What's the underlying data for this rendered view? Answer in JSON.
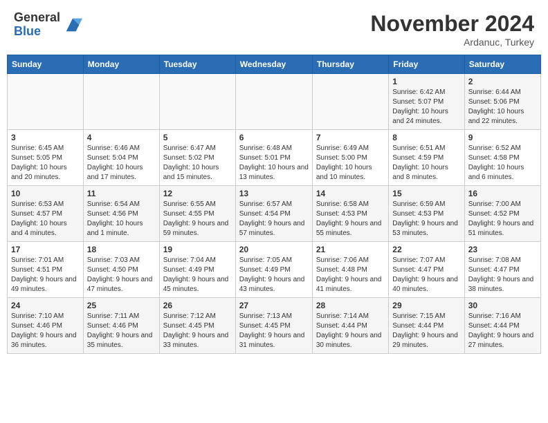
{
  "header": {
    "logo_general": "General",
    "logo_blue": "Blue",
    "month_title": "November 2024",
    "location": "Ardanuc, Turkey"
  },
  "weekdays": [
    "Sunday",
    "Monday",
    "Tuesday",
    "Wednesday",
    "Thursday",
    "Friday",
    "Saturday"
  ],
  "weeks": [
    [
      {
        "day": "",
        "info": ""
      },
      {
        "day": "",
        "info": ""
      },
      {
        "day": "",
        "info": ""
      },
      {
        "day": "",
        "info": ""
      },
      {
        "day": "",
        "info": ""
      },
      {
        "day": "1",
        "info": "Sunrise: 6:42 AM\nSunset: 5:07 PM\nDaylight: 10 hours and 24 minutes."
      },
      {
        "day": "2",
        "info": "Sunrise: 6:44 AM\nSunset: 5:06 PM\nDaylight: 10 hours and 22 minutes."
      }
    ],
    [
      {
        "day": "3",
        "info": "Sunrise: 6:45 AM\nSunset: 5:05 PM\nDaylight: 10 hours and 20 minutes."
      },
      {
        "day": "4",
        "info": "Sunrise: 6:46 AM\nSunset: 5:04 PM\nDaylight: 10 hours and 17 minutes."
      },
      {
        "day": "5",
        "info": "Sunrise: 6:47 AM\nSunset: 5:02 PM\nDaylight: 10 hours and 15 minutes."
      },
      {
        "day": "6",
        "info": "Sunrise: 6:48 AM\nSunset: 5:01 PM\nDaylight: 10 hours and 13 minutes."
      },
      {
        "day": "7",
        "info": "Sunrise: 6:49 AM\nSunset: 5:00 PM\nDaylight: 10 hours and 10 minutes."
      },
      {
        "day": "8",
        "info": "Sunrise: 6:51 AM\nSunset: 4:59 PM\nDaylight: 10 hours and 8 minutes."
      },
      {
        "day": "9",
        "info": "Sunrise: 6:52 AM\nSunset: 4:58 PM\nDaylight: 10 hours and 6 minutes."
      }
    ],
    [
      {
        "day": "10",
        "info": "Sunrise: 6:53 AM\nSunset: 4:57 PM\nDaylight: 10 hours and 4 minutes."
      },
      {
        "day": "11",
        "info": "Sunrise: 6:54 AM\nSunset: 4:56 PM\nDaylight: 10 hours and 1 minute."
      },
      {
        "day": "12",
        "info": "Sunrise: 6:55 AM\nSunset: 4:55 PM\nDaylight: 9 hours and 59 minutes."
      },
      {
        "day": "13",
        "info": "Sunrise: 6:57 AM\nSunset: 4:54 PM\nDaylight: 9 hours and 57 minutes."
      },
      {
        "day": "14",
        "info": "Sunrise: 6:58 AM\nSunset: 4:53 PM\nDaylight: 9 hours and 55 minutes."
      },
      {
        "day": "15",
        "info": "Sunrise: 6:59 AM\nSunset: 4:53 PM\nDaylight: 9 hours and 53 minutes."
      },
      {
        "day": "16",
        "info": "Sunrise: 7:00 AM\nSunset: 4:52 PM\nDaylight: 9 hours and 51 minutes."
      }
    ],
    [
      {
        "day": "17",
        "info": "Sunrise: 7:01 AM\nSunset: 4:51 PM\nDaylight: 9 hours and 49 minutes."
      },
      {
        "day": "18",
        "info": "Sunrise: 7:03 AM\nSunset: 4:50 PM\nDaylight: 9 hours and 47 minutes."
      },
      {
        "day": "19",
        "info": "Sunrise: 7:04 AM\nSunset: 4:49 PM\nDaylight: 9 hours and 45 minutes."
      },
      {
        "day": "20",
        "info": "Sunrise: 7:05 AM\nSunset: 4:49 PM\nDaylight: 9 hours and 43 minutes."
      },
      {
        "day": "21",
        "info": "Sunrise: 7:06 AM\nSunset: 4:48 PM\nDaylight: 9 hours and 41 minutes."
      },
      {
        "day": "22",
        "info": "Sunrise: 7:07 AM\nSunset: 4:47 PM\nDaylight: 9 hours and 40 minutes."
      },
      {
        "day": "23",
        "info": "Sunrise: 7:08 AM\nSunset: 4:47 PM\nDaylight: 9 hours and 38 minutes."
      }
    ],
    [
      {
        "day": "24",
        "info": "Sunrise: 7:10 AM\nSunset: 4:46 PM\nDaylight: 9 hours and 36 minutes."
      },
      {
        "day": "25",
        "info": "Sunrise: 7:11 AM\nSunset: 4:46 PM\nDaylight: 9 hours and 35 minutes."
      },
      {
        "day": "26",
        "info": "Sunrise: 7:12 AM\nSunset: 4:45 PM\nDaylight: 9 hours and 33 minutes."
      },
      {
        "day": "27",
        "info": "Sunrise: 7:13 AM\nSunset: 4:45 PM\nDaylight: 9 hours and 31 minutes."
      },
      {
        "day": "28",
        "info": "Sunrise: 7:14 AM\nSunset: 4:44 PM\nDaylight: 9 hours and 30 minutes."
      },
      {
        "day": "29",
        "info": "Sunrise: 7:15 AM\nSunset: 4:44 PM\nDaylight: 9 hours and 29 minutes."
      },
      {
        "day": "30",
        "info": "Sunrise: 7:16 AM\nSunset: 4:44 PM\nDaylight: 9 hours and 27 minutes."
      }
    ]
  ]
}
